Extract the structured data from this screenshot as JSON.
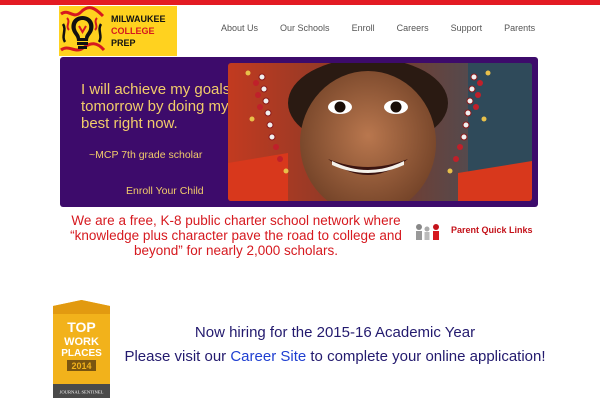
{
  "brand": {
    "line1": "MILWAUKEE",
    "line2": "COLLEGE",
    "line3": "PREP",
    "logo_colors": [
      "#ffd21f",
      "#d6191f",
      "#111111"
    ]
  },
  "nav": {
    "items": [
      "About Us",
      "Our Schools",
      "Enroll",
      "Careers",
      "Support",
      "Parents"
    ]
  },
  "hero": {
    "quote": "I will achieve my goals tomorrow by doing my best right now.",
    "attribution": "~MCP 7th grade scholar",
    "cta": "Enroll Your Child",
    "background": "#3d0b6b",
    "text_color": "#f2cc6a"
  },
  "mission": {
    "text": "We are a free, K-8 public charter school network where “knowledge plus character pave the road to college and beyond” for nearly 2,000 scholars.",
    "color": "#d6191f"
  },
  "quick_links": {
    "label": "Parent Quick Links",
    "icon": "family-icon"
  },
  "badge": {
    "line1": "TOP",
    "line2": "WORK",
    "line3": "PLACES",
    "year": "2014",
    "source": "JOURNAL SENTINEL"
  },
  "hiring": {
    "line1": "Now hiring for the 2015-16 Academic Year",
    "line2_before": "Please visit our ",
    "link_text": "Career Site",
    "line2_after": " to complete your online application!"
  }
}
